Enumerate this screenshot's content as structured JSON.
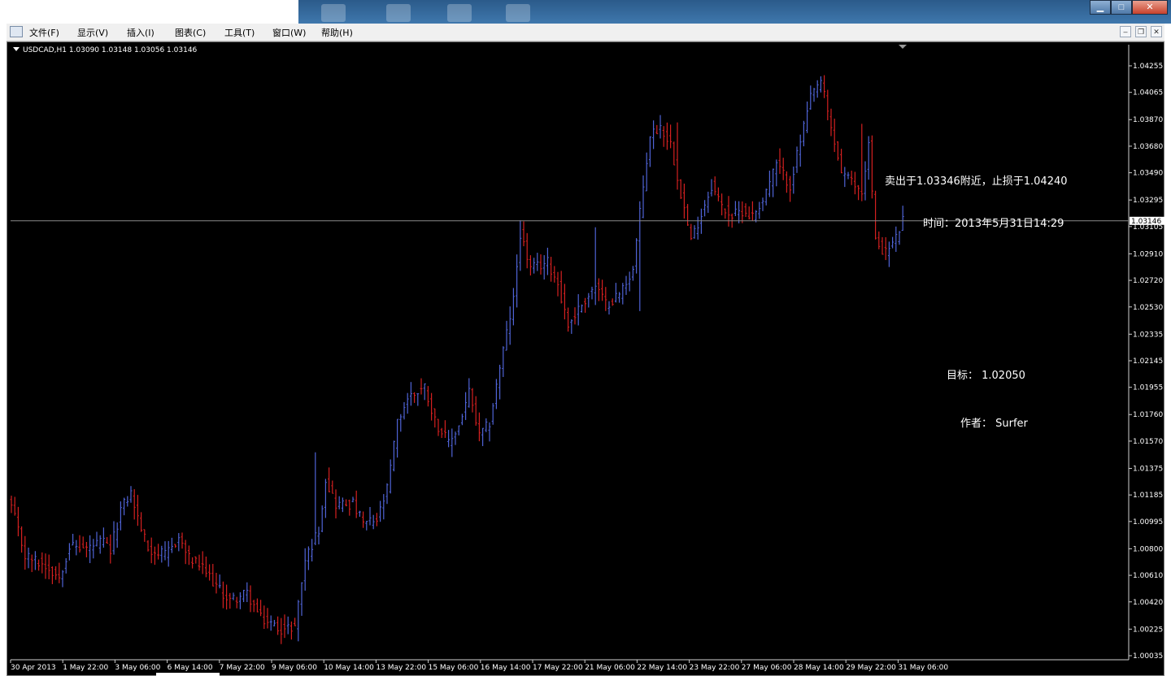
{
  "menu": {
    "items": [
      "文件(F)",
      "显示(V)",
      "插入(I)",
      "图表(C)",
      "工具(T)",
      "窗口(W)",
      "帮助(H)"
    ]
  },
  "chart_header": {
    "symbol_line": "USDCAD,H1  1.03090 1.03148 1.03056 1.03146"
  },
  "annotations": {
    "sell": "卖出于1.03346附近，止损于1.04240",
    "time": "时间：2013年5月31日14:29",
    "target": "目标： 1.02050",
    "author": "作者： Surfer"
  },
  "colors": {
    "background": "#000000",
    "bull": "#4f63d6",
    "bear": "#d42020",
    "axis_text": "#ffffff",
    "price_line": "#8a8a8a"
  },
  "chart_data": {
    "type": "bar",
    "symbol": "USDCAD",
    "timeframe": "H1",
    "current_price": 1.03146,
    "ylim": [
      1.00035,
      1.04255
    ],
    "y_ticks": [
      1.04255,
      1.04065,
      1.0387,
      1.0368,
      1.0349,
      1.03295,
      1.03105,
      1.0291,
      1.0272,
      1.0253,
      1.02335,
      1.02145,
      1.01955,
      1.0176,
      1.0157,
      1.01375,
      1.01185,
      1.00995,
      1.008,
      1.0061,
      1.0042,
      1.00225,
      1.00035
    ],
    "x_ticks": [
      "30 Apr 2013",
      "1 May 22:00",
      "3 May 06:00",
      "6 May 14:00",
      "7 May 22:00",
      "9 May 06:00",
      "10 May 14:00",
      "13 May 22:00",
      "15 May 06:00",
      "16 May 14:00",
      "17 May 22:00",
      "21 May 06:00",
      "22 May 14:00",
      "23 May 22:00",
      "27 May 06:00",
      "28 May 14:00",
      "29 May 22:00",
      "31 May 06:00"
    ],
    "series_path": [
      [
        0,
        1.011
      ],
      [
        4,
        1.0075
      ],
      [
        10,
        1.0068
      ],
      [
        14,
        1.006
      ],
      [
        17,
        1.0082
      ],
      [
        22,
        1.008
      ],
      [
        27,
        1.0085
      ],
      [
        29,
        1.0078
      ],
      [
        32,
        1.0108
      ],
      [
        35,
        1.012
      ],
      [
        37,
        1.0102
      ],
      [
        40,
        1.008
      ],
      [
        45,
        1.0075
      ],
      [
        49,
        1.0088
      ],
      [
        52,
        1.0073
      ],
      [
        55,
        1.0068
      ],
      [
        58,
        1.006
      ],
      [
        61,
        1.005
      ],
      [
        64,
        1.0043
      ],
      [
        69,
        1.0048
      ],
      [
        73,
        1.003
      ],
      [
        77,
        1.0025
      ],
      [
        80,
        1.0022
      ],
      [
        83,
        1.0025
      ],
      [
        86,
        1.0072
      ],
      [
        90,
        1.0094
      ],
      [
        92,
        1.013
      ],
      [
        95,
        1.0112
      ],
      [
        100,
        1.0112
      ],
      [
        103,
        1.0098
      ],
      [
        107,
        1.01
      ],
      [
        110,
        1.0122
      ],
      [
        113,
        1.017
      ],
      [
        116,
        1.0188
      ],
      [
        121,
        1.0196
      ],
      [
        124,
        1.0172
      ],
      [
        128,
        1.0155
      ],
      [
        131,
        1.0168
      ],
      [
        134,
        1.0192
      ],
      [
        137,
        1.016
      ],
      [
        140,
        1.017
      ],
      [
        143,
        1.021
      ],
      [
        147,
        1.0258
      ],
      [
        149,
        1.0306
      ],
      [
        152,
        1.028
      ],
      [
        157,
        1.0285
      ],
      [
        160,
        1.027
      ],
      [
        163,
        1.024
      ],
      [
        167,
        1.0255
      ],
      [
        171,
        1.0268
      ],
      [
        174,
        1.0255
      ],
      [
        178,
        1.0262
      ],
      [
        182,
        1.028
      ],
      [
        184,
        1.032
      ],
      [
        187,
        1.0376
      ],
      [
        190,
        1.0382
      ],
      [
        193,
        1.037
      ],
      [
        196,
        1.0335
      ],
      [
        199,
        1.03
      ],
      [
        202,
        1.032
      ],
      [
        205,
        1.034
      ],
      [
        208,
        1.0325
      ],
      [
        211,
        1.0318
      ],
      [
        214,
        1.0322
      ],
      [
        217,
        1.0318
      ],
      [
        220,
        1.033
      ],
      [
        224,
        1.0355
      ],
      [
        228,
        1.034
      ],
      [
        231,
        1.0372
      ],
      [
        234,
        1.0402
      ],
      [
        237,
        1.0415
      ],
      [
        240,
        1.038
      ],
      [
        243,
        1.035
      ],
      [
        246,
        1.0342
      ],
      [
        249,
        1.0335
      ],
      [
        251,
        1.037
      ],
      [
        253,
        1.03
      ],
      [
        256,
        1.0292
      ],
      [
        259,
        1.0302
      ],
      [
        261,
        1.0315
      ]
    ],
    "high_low_spikes": [
      [
        89,
        1.0149
      ],
      [
        149,
        1.0315
      ],
      [
        171,
        1.031
      ],
      [
        184,
        1.025
      ],
      [
        195,
        1.0385
      ],
      [
        237,
        1.0418
      ],
      [
        249,
        1.0384
      ]
    ]
  }
}
